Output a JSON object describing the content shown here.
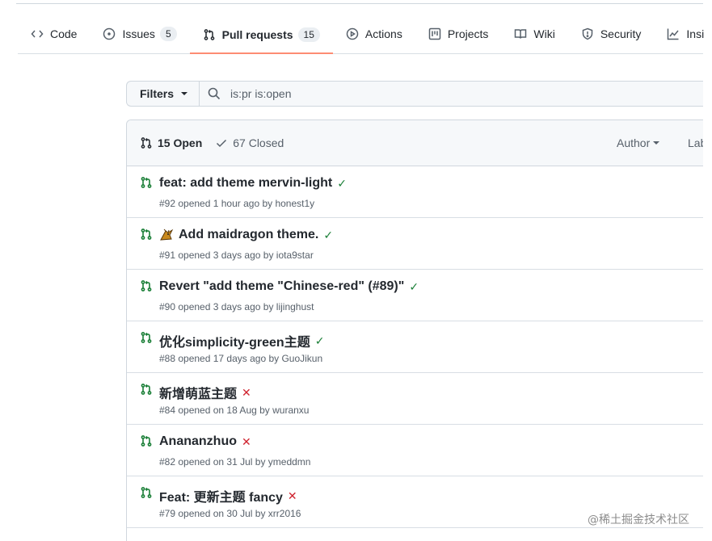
{
  "tabs": [
    {
      "label": "Code",
      "icon": "code-icon"
    },
    {
      "label": "Issues",
      "icon": "issue-icon",
      "count": "5"
    },
    {
      "label": "Pull requests",
      "icon": "pull-request-icon",
      "count": "15",
      "selected": true
    },
    {
      "label": "Actions",
      "icon": "play-icon"
    },
    {
      "label": "Projects",
      "icon": "project-icon"
    },
    {
      "label": "Wiki",
      "icon": "book-icon"
    },
    {
      "label": "Security",
      "icon": "shield-icon"
    },
    {
      "label": "Insi",
      "icon": "graph-icon"
    }
  ],
  "filter_bar": {
    "filters_label": "Filters",
    "search_value": "is:pr is:open"
  },
  "list_header": {
    "open_label": "15 Open",
    "closed_label": "67 Closed",
    "author_label": "Author",
    "labels_label": "Lab"
  },
  "pull_requests": [
    {
      "title": "feat: add theme mervin-light",
      "status": "success",
      "meta": "#92 opened 1 hour ago by honest1y"
    },
    {
      "title": "Add maidragon theme.",
      "status": "success",
      "emoji": "dragon",
      "meta": "#91 opened 3 days ago by iota9star"
    },
    {
      "title": "Revert \"add theme \"Chinese-red\" (#89)\"",
      "status": "success",
      "meta": "#90 opened 3 days ago by lijinghust"
    },
    {
      "title": "优化simplicity-green主题",
      "status": "success",
      "meta": "#88 opened 17 days ago by GuoJikun"
    },
    {
      "title": "新增萌蓝主题",
      "status": "failure",
      "meta": "#84 opened on 18 Aug by wuranxu"
    },
    {
      "title": "Anananzhuo",
      "status": "failure",
      "meta": "#82 opened on 31 Jul by ymeddmn"
    },
    {
      "title": "Feat: 更新主题 fancy",
      "status": "failure",
      "meta": "#79 opened on 30 Jul by xrr2016"
    }
  ],
  "status_symbols": {
    "success": "✓",
    "failure": "✕"
  },
  "colors": {
    "accent": "#fd8c73",
    "open_green": "#1a7f37",
    "fail_red": "#cf222e"
  },
  "watermark": "@稀土掘金技术社区"
}
